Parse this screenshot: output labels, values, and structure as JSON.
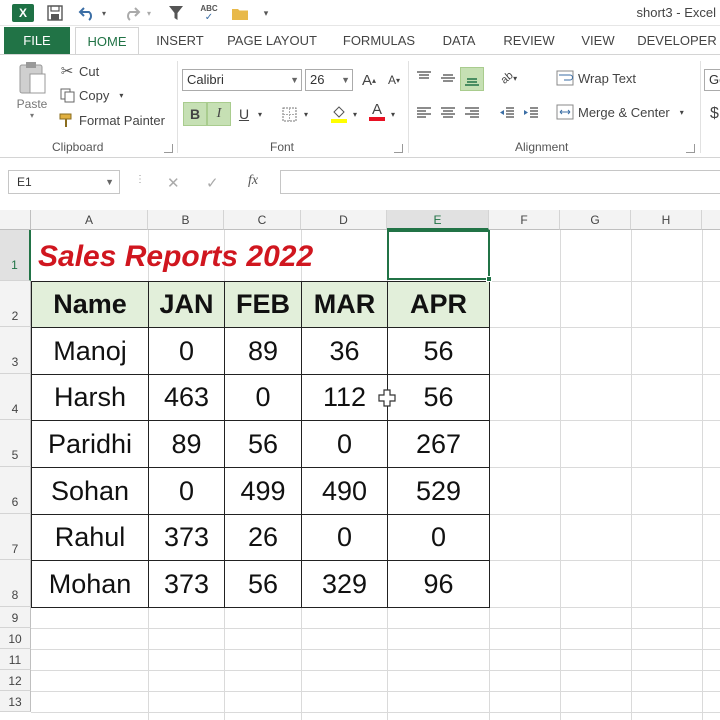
{
  "titlebar": {
    "excel_icon": "X",
    "save_icon": "save-icon",
    "undo_icon": "undo-icon",
    "redo_icon": "redo-icon",
    "filter_icon": "filter-icon",
    "spelling_icon": "spelling-icon",
    "folder_icon": "folder-icon",
    "window_title": "short3 - Excel"
  },
  "tabs": [
    "FILE",
    "HOME",
    "INSERT",
    "PAGE LAYOUT",
    "FORMULAS",
    "DATA",
    "REVIEW",
    "VIEW",
    "DEVELOPER"
  ],
  "active_tab": "HOME",
  "clipboard": {
    "paste": "Paste",
    "cut": "Cut",
    "copy": "Copy",
    "format_painter": "Format Painter",
    "group_label": "Clipboard"
  },
  "font": {
    "family": "Calibri",
    "size": "26",
    "bold": "B",
    "italic": "I",
    "underline": "U",
    "font_color_glyph": "A",
    "grow_glyph": "A",
    "shrink_glyph": "A",
    "group_label": "Font"
  },
  "alignment": {
    "wrap_text": "Wrap Text",
    "merge_center": "Merge & Center",
    "group_label": "Alignment"
  },
  "number": {
    "format_partial": "Ge",
    "currency_partial": "$"
  },
  "formula_bar": {
    "name_box": "E1",
    "fx": "fx",
    "cancel_glyph": "✕",
    "enter_glyph": "✓",
    "value": ""
  },
  "grid": {
    "columns": [
      "A",
      "B",
      "C",
      "D",
      "E",
      "F",
      "G",
      "H"
    ],
    "rows": [
      "1",
      "2",
      "3",
      "4",
      "5",
      "6",
      "7",
      "8",
      "9",
      "10",
      "11",
      "12",
      "13"
    ],
    "selected_column": "E",
    "selected_cell": "E1"
  },
  "sheet": {
    "title": "Sales Reports 2022",
    "headers": [
      "Name",
      "JAN",
      "FEB",
      "MAR",
      "APR"
    ],
    "rows": [
      [
        "Manoj",
        "0",
        "89",
        "36",
        "56"
      ],
      [
        "Harsh",
        "463",
        "0",
        "112",
        "56"
      ],
      [
        "Paridhi",
        "89",
        "56",
        "0",
        "267"
      ],
      [
        "Sohan",
        "0",
        "499",
        "490",
        "529"
      ],
      [
        "Rahul",
        "373",
        "26",
        "0",
        "0"
      ],
      [
        "Mohan",
        "373",
        "56",
        "329",
        "96"
      ]
    ]
  },
  "colors": {
    "excel_green": "#217346",
    "header_fill": "#e2efda",
    "title_red": "#d0161f"
  }
}
